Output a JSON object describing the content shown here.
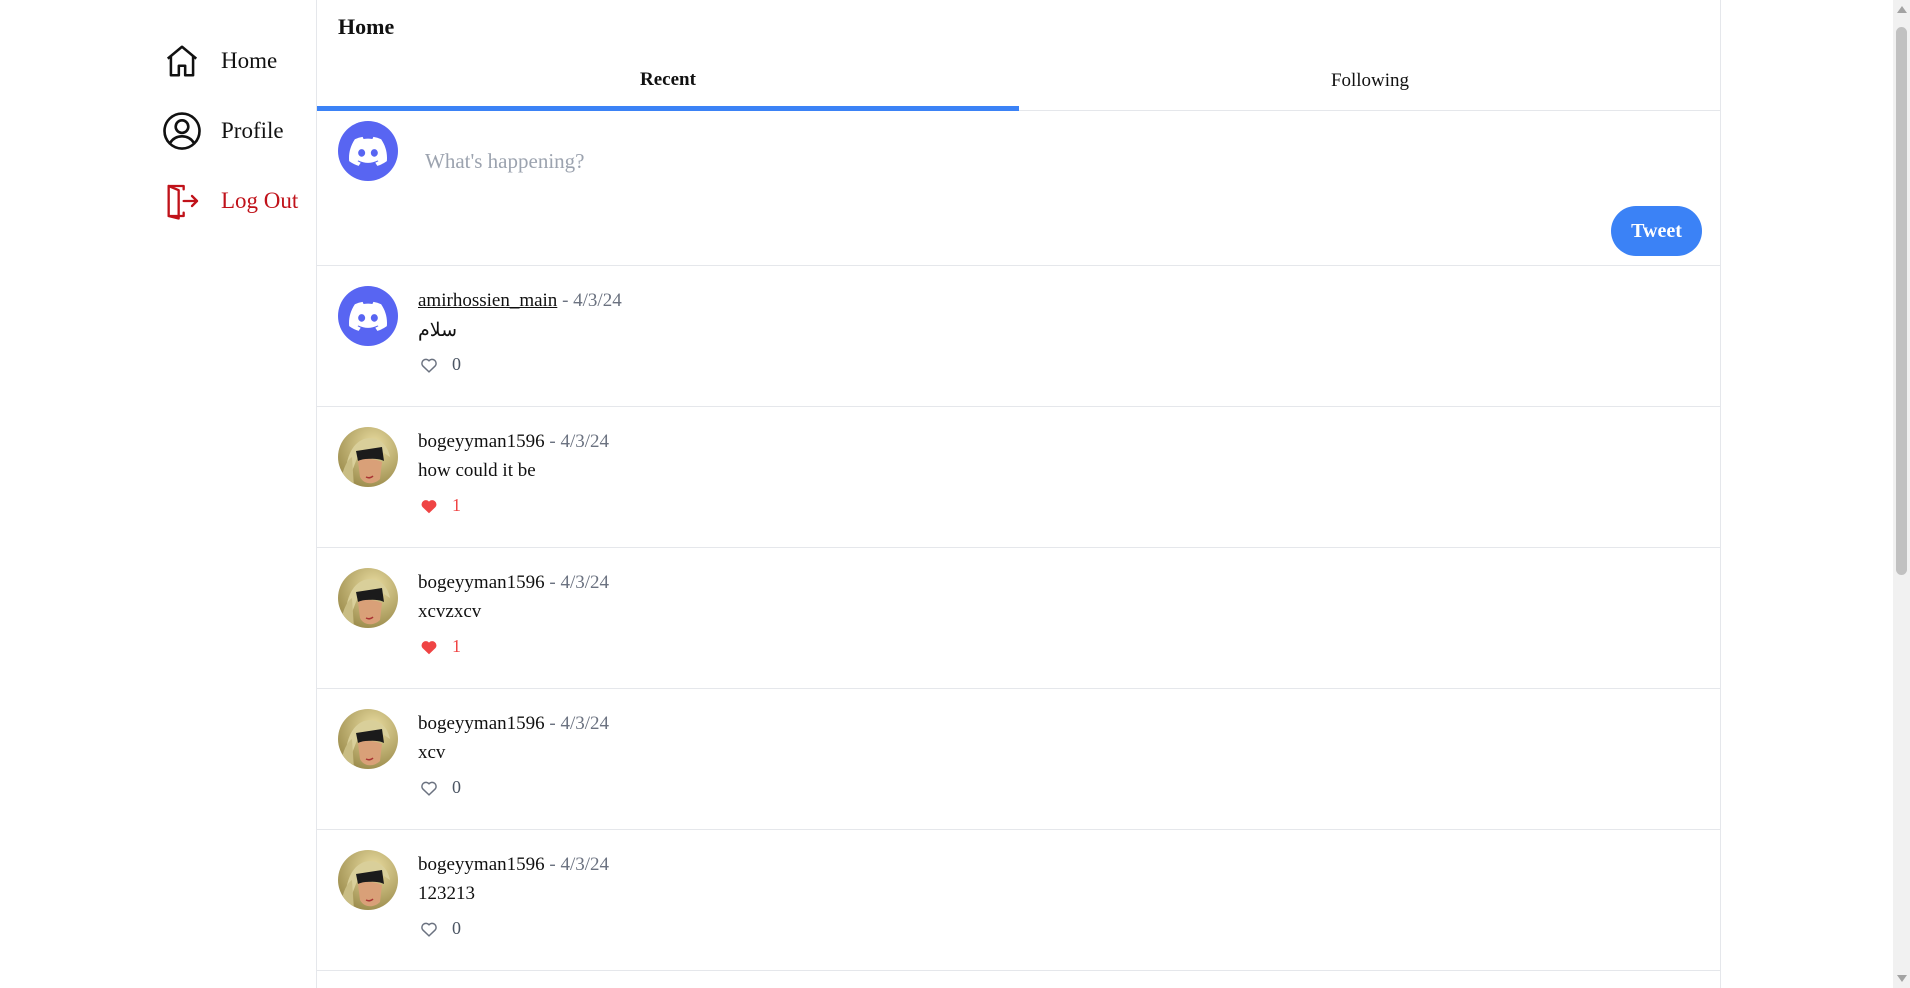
{
  "colors": {
    "accent": "#3b82f6",
    "logout": "#c0121a",
    "like": "#ef4444",
    "discord": "#5865f2"
  },
  "sidebar": {
    "items": [
      {
        "label": "Home",
        "icon": "home-icon"
      },
      {
        "label": "Profile",
        "icon": "user-circle-icon"
      },
      {
        "label": "Log Out",
        "icon": "logout-icon"
      }
    ]
  },
  "header": {
    "title": "Home"
  },
  "tabs": [
    {
      "label": "Recent",
      "active": true
    },
    {
      "label": "Following",
      "active": false
    }
  ],
  "composer": {
    "placeholder": "What's happening?",
    "value": "",
    "button_label": "Tweet"
  },
  "posts": [
    {
      "author": "amirhossien_main",
      "date": "- 4/3/24",
      "content": "سلام",
      "likes": "0",
      "liked": false,
      "avatar": "discord-icon"
    },
    {
      "author": "bogeyyman1596",
      "date": "- 4/3/24",
      "content": "how could it be",
      "likes": "1",
      "liked": true,
      "avatar": "anime-avatar"
    },
    {
      "author": "bogeyyman1596",
      "date": "- 4/3/24",
      "content": "xcvzxcv",
      "likes": "1",
      "liked": true,
      "avatar": "anime-avatar"
    },
    {
      "author": "bogeyyman1596",
      "date": "- 4/3/24",
      "content": "xcv",
      "likes": "0",
      "liked": false,
      "avatar": "anime-avatar"
    },
    {
      "author": "bogeyyman1596",
      "date": "- 4/3/24",
      "content": "123213",
      "likes": "0",
      "liked": false,
      "avatar": "anime-avatar"
    }
  ]
}
